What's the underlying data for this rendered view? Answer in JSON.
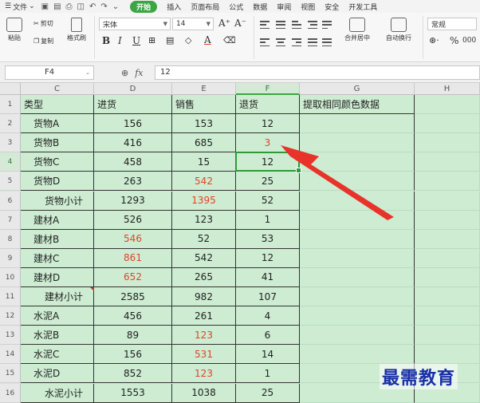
{
  "menu": {
    "file": "文件",
    "tabs": [
      "开始",
      "插入",
      "页面布局",
      "公式",
      "数据",
      "审阅",
      "视图",
      "安全",
      "开发工具"
    ],
    "active_tab": "开始"
  },
  "ribbon": {
    "paste": "粘贴",
    "cut": "剪切",
    "copy": "复制",
    "format_painter": "格式刷",
    "font_name": "宋体",
    "font_size": "14",
    "bold": "B",
    "italic": "I",
    "underline": "U",
    "merge_center": "合并居中",
    "auto_wrap": "自动换行",
    "number_format": "常规",
    "percent": "%"
  },
  "formula_bar": {
    "cell_ref": "F4",
    "fx": "fx",
    "value": "12"
  },
  "columns": [
    "C",
    "D",
    "E",
    "F",
    "G",
    "H"
  ],
  "rows": [
    {
      "n": "1",
      "c": "类型",
      "d": "进货",
      "e": "销售",
      "f": "退货",
      "g": "提取相同颜色数据",
      "header": true
    },
    {
      "n": "2",
      "c": "货物A",
      "d": "156",
      "e": "153",
      "f": "12"
    },
    {
      "n": "3",
      "c": "货物B",
      "d": "416",
      "e": "685",
      "f": "3",
      "f_red": true
    },
    {
      "n": "4",
      "c": "货物C",
      "d": "458",
      "e": "15",
      "f": "12"
    },
    {
      "n": "5",
      "c": "货物D",
      "d": "263",
      "e": "542",
      "f": "25",
      "e_red": true
    },
    {
      "n": "6",
      "c": "货物小计",
      "d": "1293",
      "e": "1395",
      "f": "52",
      "e_red": true,
      "sub": true
    },
    {
      "n": "7",
      "c": "建材A",
      "d": "526",
      "e": "123",
      "f": "1"
    },
    {
      "n": "8",
      "c": "建材B",
      "d": "546",
      "e": "52",
      "f": "53",
      "d_red": true
    },
    {
      "n": "9",
      "c": "建材C",
      "d": "861",
      "e": "542",
      "f": "12",
      "d_red": true
    },
    {
      "n": "10",
      "c": "建材D",
      "d": "652",
      "e": "265",
      "f": "41",
      "d_red": true
    },
    {
      "n": "11",
      "c": "建材小计",
      "d": "2585",
      "e": "982",
      "f": "107",
      "sub": true
    },
    {
      "n": "12",
      "c": "水泥A",
      "d": "456",
      "e": "261",
      "f": "4"
    },
    {
      "n": "13",
      "c": "水泥B",
      "d": "89",
      "e": "123",
      "f": "6",
      "e_red": true
    },
    {
      "n": "14",
      "c": "水泥C",
      "d": "156",
      "e": "531",
      "f": "14",
      "e_red": true
    },
    {
      "n": "15",
      "c": "水泥D",
      "d": "852",
      "e": "123",
      "f": "1",
      "e_red": true
    },
    {
      "n": "16",
      "c": "水泥小计",
      "d": "1553",
      "e": "1038",
      "f": "25",
      "sub": true
    }
  ],
  "selected": {
    "col": "F",
    "row": "4"
  },
  "watermark": "最需教育",
  "colors": {
    "accent": "#3ca544",
    "grid_bg": "#cdecd2",
    "red_text": "#e0442a",
    "arrow": "#e8332a",
    "watermark": "#1a2fa8"
  }
}
